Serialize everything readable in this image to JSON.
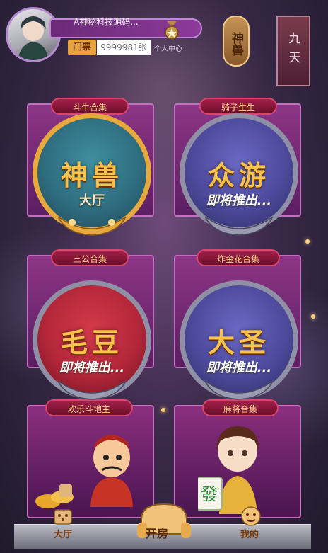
{
  "header": {
    "username": "A神秘科技源码...",
    "ticket_label": "门票",
    "ticket_value": "9999981张",
    "personal_center": "个人中心",
    "beast_button": "神兽",
    "jiutian": "九天"
  },
  "tiles": [
    {
      "ribbon": "斗牛合集"
    },
    {
      "ribbon": "骑子生生"
    },
    {
      "ribbon": "三公合集"
    },
    {
      "ribbon": "炸金花合集"
    },
    {
      "ribbon": "欢乐斗地主"
    },
    {
      "ribbon": "麻将合集"
    }
  ],
  "games": [
    {
      "title": "神兽",
      "subtitle": "大厅"
    },
    {
      "title": "众游",
      "subtitle": "即将推出..."
    },
    {
      "title": "毛豆",
      "subtitle": "即将推出..."
    },
    {
      "title": "大圣",
      "subtitle": "即将推出..."
    }
  ],
  "nav": {
    "hall": "大厅",
    "open_room": "开房",
    "mine": "我的"
  },
  "colors": {
    "gold": "#f7c14b",
    "purple_tile": "#8d3586",
    "teal_medallion": "#2f6e80",
    "blue_medallion": "#4d4a9c",
    "red_medallion": "#b3273a"
  }
}
